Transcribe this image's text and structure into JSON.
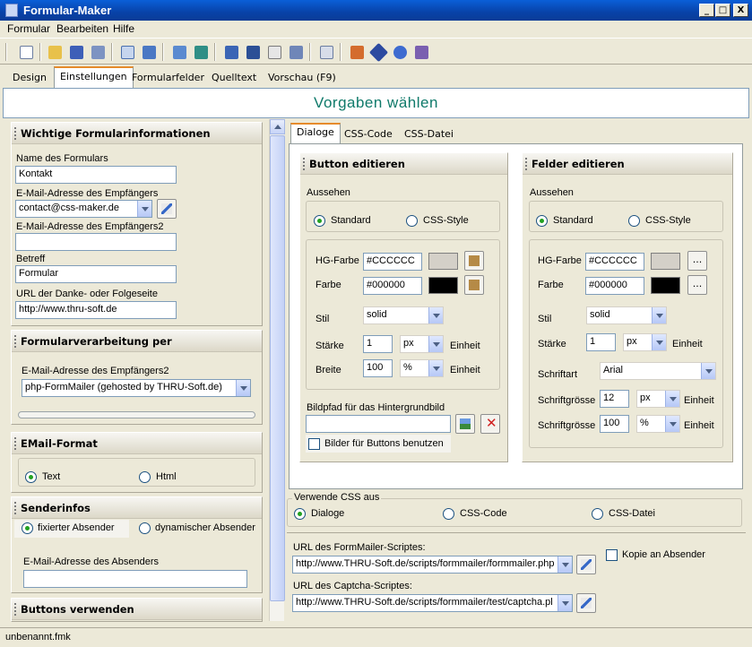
{
  "window": {
    "title": "Formular-Maker",
    "min": "_",
    "max": "□",
    "close": "X"
  },
  "menu": [
    "Formular",
    "Bearbeiten",
    "Hilfe"
  ],
  "tabs": [
    "Design",
    "Einstellungen",
    "Formularfelder",
    "Quelltext",
    "Vorschau (F9)"
  ],
  "active_tab": "Einstellungen",
  "header": {
    "title": "Vorgaben wählen"
  },
  "left": {
    "info": {
      "title": "Wichtige Formularinformationen",
      "name_label": "Name des Formulars",
      "name_value": "Kontakt",
      "email_label": "E-Mail-Adresse des Empfängers",
      "email_value": "contact@css-maker.de",
      "email2_label": "E-Mail-Adresse des Empfängers2",
      "email2_value": "",
      "subject_label": "Betreff",
      "subject_value": "Formular",
      "url_label": "URL der Danke- oder Folgeseite",
      "url_value": "http://www.thru-soft.de"
    },
    "processing": {
      "title": "Formularverarbeitung per",
      "label": "E-Mail-Adresse des Empfängers2",
      "value": "php-FormMailer (gehosted by THRU-Soft.de)"
    },
    "format": {
      "title": "EMail-Format",
      "opt1": "Text",
      "opt2": "Html"
    },
    "sender": {
      "title": "Senderinfos",
      "opt1": "fixierter Absender",
      "opt2": "dynamischer Absender",
      "email_label": "E-Mail-Adresse des Absenders",
      "email_value": ""
    },
    "buttons": {
      "title": "Buttons verwenden"
    }
  },
  "right": {
    "tabs": [
      "Dialoge",
      "CSS-Code",
      "CSS-Datei"
    ],
    "button_edit": {
      "title": "Button editieren",
      "look_label": "Aussehen",
      "opt1": "Standard",
      "opt2": "CSS-Style",
      "bg_label": "HG-Farbe",
      "bg_value": "#CCCCCC",
      "fg_label": "Farbe",
      "fg_value": "#000000",
      "style_label": "Stil",
      "style_value": "solid",
      "strength_label": "Stärke",
      "strength_value": "1",
      "strength_unit": "px",
      "width_label": "Breite",
      "width_value": "100",
      "width_unit": "%",
      "unit_label": "Einheit",
      "bgimg_label": "Bildpfad für das Hintergrundbild",
      "bgimg_value": "",
      "use_images_label": "Bilder für Buttons benutzen"
    },
    "field_edit": {
      "title": "Felder editieren",
      "look_label": "Aussehen",
      "opt1": "Standard",
      "opt2": "CSS-Style",
      "bg_label": "HG-Farbe",
      "bg_value": "#CCCCCC",
      "fg_label": "Farbe",
      "fg_value": "#000000",
      "style_label": "Stil",
      "style_value": "solid",
      "strength_label": "Stärke",
      "strength_value": "1",
      "strength_unit": "px",
      "unit_label": "Einheit",
      "font_label": "Schriftart",
      "font_value": "Arial",
      "size_label": "Schriftgrösse",
      "size_value": "12",
      "size_unit": "px",
      "size2_label": "Schriftgrösse",
      "size2_value": "100",
      "size2_unit": "%",
      "dots": "..."
    },
    "css_source": {
      "title": "Verwende CSS aus",
      "opt1": "Dialoge",
      "opt2": "CSS-Code",
      "opt3": "CSS-Datei"
    },
    "scripts": {
      "formmailer_label": "URL des FormMailer-Scriptes:",
      "formmailer_value": "http://www.THRU-Soft.de/scripts/formmailer/formmailer.php",
      "captcha_label": "URL des Captcha-Scriptes:",
      "captcha_value": "http://www.THRU-Soft.de/scripts/formmailer/test/captcha.pl",
      "copy_label": "Kopie an Absender"
    }
  },
  "status": {
    "file": "unbenannt.fmk"
  },
  "colors": {
    "accent": "#0f7a6a",
    "titlebar": "#0842a8",
    "swatch_bg": "#cccccc",
    "swatch_fg": "#000000"
  }
}
